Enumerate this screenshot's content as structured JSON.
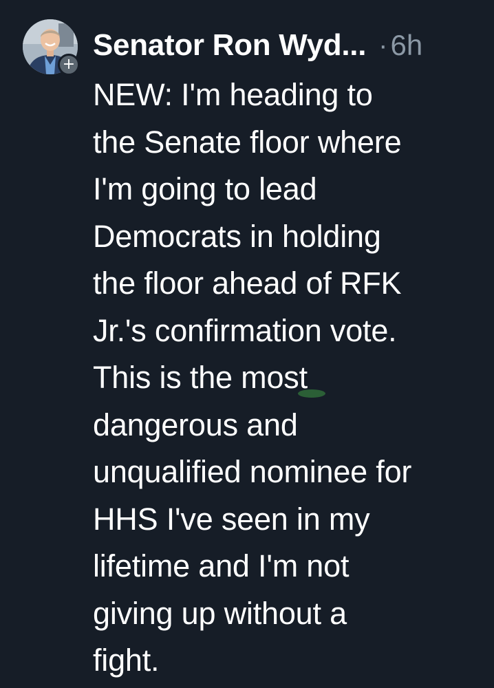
{
  "post": {
    "author": "Senator Ron Wyd...",
    "separator": "·",
    "time": "6h",
    "follow_symbol": "+",
    "lines": [
      "NEW: I'm heading to",
      "the Senate floor where",
      "I'm going to lead",
      "Democrats in holding",
      "the floor ahead of RFK",
      "Jr.'s confirmation vote.",
      "This is the most",
      "dangerous and",
      "unqualified nominee for",
      "HHS I've seen in my",
      "lifetime and I'm not",
      "giving up without a",
      "fight."
    ]
  },
  "colors": {
    "background": "#161d27",
    "text": "#ffffff",
    "muted": "#8b98a5"
  },
  "icons": {
    "avatar": "profile-photo",
    "follow": "plus-icon"
  }
}
